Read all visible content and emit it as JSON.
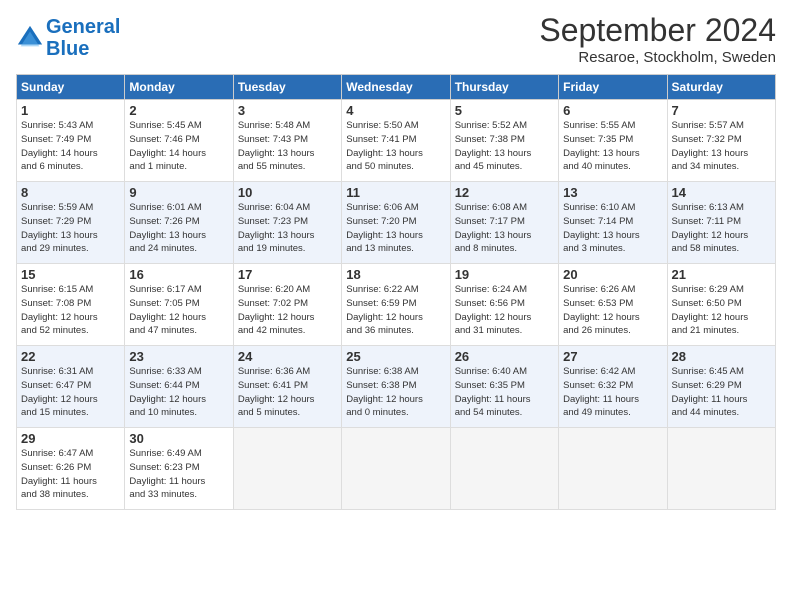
{
  "header": {
    "logo_line1": "General",
    "logo_line2": "Blue",
    "month_year": "September 2024",
    "location": "Resaroe, Stockholm, Sweden"
  },
  "days_of_week": [
    "Sunday",
    "Monday",
    "Tuesday",
    "Wednesday",
    "Thursday",
    "Friday",
    "Saturday"
  ],
  "weeks": [
    [
      {
        "day": 1,
        "info": "Sunrise: 5:43 AM\nSunset: 7:49 PM\nDaylight: 14 hours\nand 6 minutes."
      },
      {
        "day": 2,
        "info": "Sunrise: 5:45 AM\nSunset: 7:46 PM\nDaylight: 14 hours\nand 1 minute."
      },
      {
        "day": 3,
        "info": "Sunrise: 5:48 AM\nSunset: 7:43 PM\nDaylight: 13 hours\nand 55 minutes."
      },
      {
        "day": 4,
        "info": "Sunrise: 5:50 AM\nSunset: 7:41 PM\nDaylight: 13 hours\nand 50 minutes."
      },
      {
        "day": 5,
        "info": "Sunrise: 5:52 AM\nSunset: 7:38 PM\nDaylight: 13 hours\nand 45 minutes."
      },
      {
        "day": 6,
        "info": "Sunrise: 5:55 AM\nSunset: 7:35 PM\nDaylight: 13 hours\nand 40 minutes."
      },
      {
        "day": 7,
        "info": "Sunrise: 5:57 AM\nSunset: 7:32 PM\nDaylight: 13 hours\nand 34 minutes."
      }
    ],
    [
      {
        "day": 8,
        "info": "Sunrise: 5:59 AM\nSunset: 7:29 PM\nDaylight: 13 hours\nand 29 minutes."
      },
      {
        "day": 9,
        "info": "Sunrise: 6:01 AM\nSunset: 7:26 PM\nDaylight: 13 hours\nand 24 minutes."
      },
      {
        "day": 10,
        "info": "Sunrise: 6:04 AM\nSunset: 7:23 PM\nDaylight: 13 hours\nand 19 minutes."
      },
      {
        "day": 11,
        "info": "Sunrise: 6:06 AM\nSunset: 7:20 PM\nDaylight: 13 hours\nand 13 minutes."
      },
      {
        "day": 12,
        "info": "Sunrise: 6:08 AM\nSunset: 7:17 PM\nDaylight: 13 hours\nand 8 minutes."
      },
      {
        "day": 13,
        "info": "Sunrise: 6:10 AM\nSunset: 7:14 PM\nDaylight: 13 hours\nand 3 minutes."
      },
      {
        "day": 14,
        "info": "Sunrise: 6:13 AM\nSunset: 7:11 PM\nDaylight: 12 hours\nand 58 minutes."
      }
    ],
    [
      {
        "day": 15,
        "info": "Sunrise: 6:15 AM\nSunset: 7:08 PM\nDaylight: 12 hours\nand 52 minutes."
      },
      {
        "day": 16,
        "info": "Sunrise: 6:17 AM\nSunset: 7:05 PM\nDaylight: 12 hours\nand 47 minutes."
      },
      {
        "day": 17,
        "info": "Sunrise: 6:20 AM\nSunset: 7:02 PM\nDaylight: 12 hours\nand 42 minutes."
      },
      {
        "day": 18,
        "info": "Sunrise: 6:22 AM\nSunset: 6:59 PM\nDaylight: 12 hours\nand 36 minutes."
      },
      {
        "day": 19,
        "info": "Sunrise: 6:24 AM\nSunset: 6:56 PM\nDaylight: 12 hours\nand 31 minutes."
      },
      {
        "day": 20,
        "info": "Sunrise: 6:26 AM\nSunset: 6:53 PM\nDaylight: 12 hours\nand 26 minutes."
      },
      {
        "day": 21,
        "info": "Sunrise: 6:29 AM\nSunset: 6:50 PM\nDaylight: 12 hours\nand 21 minutes."
      }
    ],
    [
      {
        "day": 22,
        "info": "Sunrise: 6:31 AM\nSunset: 6:47 PM\nDaylight: 12 hours\nand 15 minutes."
      },
      {
        "day": 23,
        "info": "Sunrise: 6:33 AM\nSunset: 6:44 PM\nDaylight: 12 hours\nand 10 minutes."
      },
      {
        "day": 24,
        "info": "Sunrise: 6:36 AM\nSunset: 6:41 PM\nDaylight: 12 hours\nand 5 minutes."
      },
      {
        "day": 25,
        "info": "Sunrise: 6:38 AM\nSunset: 6:38 PM\nDaylight: 12 hours\nand 0 minutes."
      },
      {
        "day": 26,
        "info": "Sunrise: 6:40 AM\nSunset: 6:35 PM\nDaylight: 11 hours\nand 54 minutes."
      },
      {
        "day": 27,
        "info": "Sunrise: 6:42 AM\nSunset: 6:32 PM\nDaylight: 11 hours\nand 49 minutes."
      },
      {
        "day": 28,
        "info": "Sunrise: 6:45 AM\nSunset: 6:29 PM\nDaylight: 11 hours\nand 44 minutes."
      }
    ],
    [
      {
        "day": 29,
        "info": "Sunrise: 6:47 AM\nSunset: 6:26 PM\nDaylight: 11 hours\nand 38 minutes."
      },
      {
        "day": 30,
        "info": "Sunrise: 6:49 AM\nSunset: 6:23 PM\nDaylight: 11 hours\nand 33 minutes."
      },
      null,
      null,
      null,
      null,
      null
    ]
  ]
}
